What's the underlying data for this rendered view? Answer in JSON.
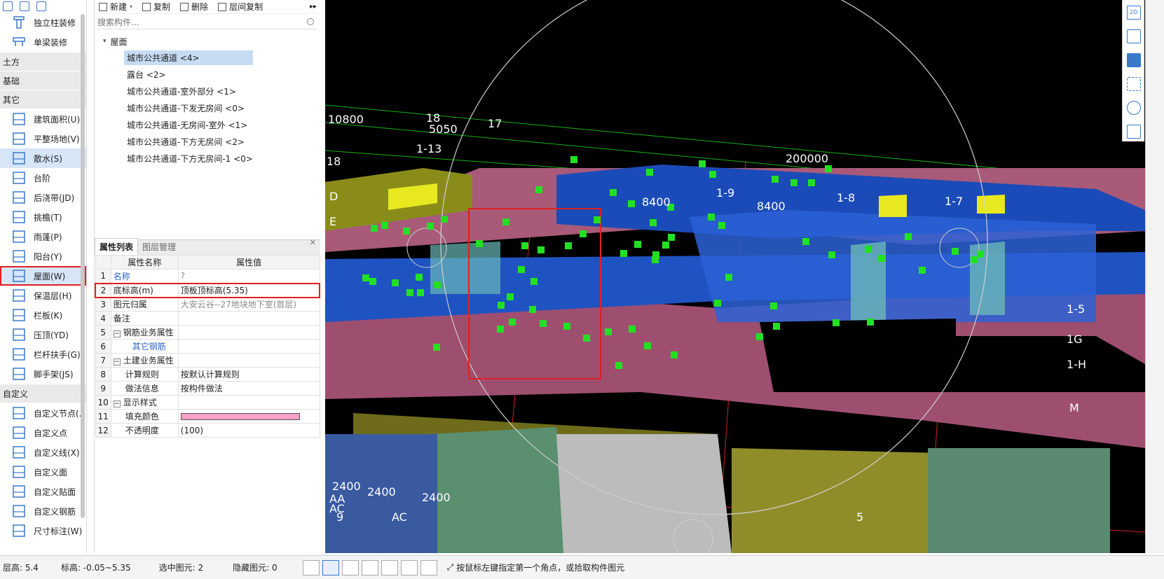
{
  "sidebar": {
    "top_items": [
      {
        "label": "独立柱装修",
        "icon": "column-finish-icon"
      },
      {
        "label": "单梁装修",
        "icon": "beam-finish-icon"
      }
    ],
    "categories": {
      "earthwork": "土方",
      "foundation": "基础",
      "other": "其它",
      "custom": "自定义"
    },
    "other_items": [
      {
        "label": "建筑面积(U)",
        "icon": "building-area-icon"
      },
      {
        "label": "平整场地(V)",
        "icon": "site-leveling-icon"
      },
      {
        "label": "散水(S)",
        "icon": "apron-icon"
      },
      {
        "label": "台阶",
        "icon": "steps-icon"
      },
      {
        "label": "后浇带(JD)",
        "icon": "post-pour-strip-icon"
      },
      {
        "label": "挑檐(T)",
        "icon": "eave-icon"
      },
      {
        "label": "雨蓬(P)",
        "icon": "canopy-icon"
      },
      {
        "label": "阳台(Y)",
        "icon": "balcony-icon"
      },
      {
        "label": "屋面(W)",
        "icon": "roof-icon"
      },
      {
        "label": "保温层(H)",
        "icon": "insulation-icon"
      },
      {
        "label": "栏板(K)",
        "icon": "parapet-icon"
      },
      {
        "label": "压顶(YD)",
        "icon": "coping-icon"
      },
      {
        "label": "栏杆扶手(G)",
        "icon": "railing-icon"
      },
      {
        "label": "脚手架(JS)",
        "icon": "scaffold-icon"
      }
    ],
    "custom_items": [
      {
        "label": "自定义节点(.",
        "icon": "custom-node-icon"
      },
      {
        "label": "自定义点",
        "icon": "custom-point-icon"
      },
      {
        "label": "自定义线(X)",
        "icon": "custom-line-icon"
      },
      {
        "label": "自定义面",
        "icon": "custom-face-icon"
      },
      {
        "label": "自定义贴面",
        "icon": "custom-veneer-icon"
      },
      {
        "label": "自定义钢筋",
        "icon": "custom-rebar-icon"
      },
      {
        "label": "尺寸标注(W)",
        "icon": "dimension-icon"
      }
    ]
  },
  "toolbar": {
    "new_label": "新建",
    "copy_label": "复制",
    "delete_label": "删除",
    "floor_copy_label": "层间复制"
  },
  "search": {
    "placeholder": "搜索构件..."
  },
  "tree": {
    "root": "屋面",
    "items": [
      "城市公共通道 <4>",
      "露台 <2>",
      "城市公共通道-室外部分 <1>",
      "城市公共通道-下发无房间 <0>",
      "城市公共通道-无房间-室外 <1>",
      "城市公共通道-下方无房间 <2>",
      "城市公共通道-下方无房间-1 <0>"
    ]
  },
  "property_tabs": {
    "active": "属性列表",
    "inactive": "图层管理"
  },
  "property_table": {
    "header_name": "属性名称",
    "header_value": "属性值",
    "rows": [
      {
        "n": "1",
        "name": "名称",
        "value": "?"
      },
      {
        "n": "2",
        "name": "底标高(m)",
        "value": "顶板顶标高(5.35)"
      },
      {
        "n": "3",
        "name": "图元归属",
        "value": "大安云谷--27地块地下室(首层)"
      },
      {
        "n": "4",
        "name": "备注",
        "value": ""
      },
      {
        "n": "5",
        "name": "钢筋业务属性",
        "value": ""
      },
      {
        "n": "6",
        "name": "其它钢筋",
        "value": ""
      },
      {
        "n": "7",
        "name": "土建业务属性",
        "value": ""
      },
      {
        "n": "8",
        "name": "计算规则",
        "value": "按默认计算规则"
      },
      {
        "n": "9",
        "name": "做法信息",
        "value": "按构件做法"
      },
      {
        "n": "10",
        "name": "显示样式",
        "value": ""
      },
      {
        "n": "11",
        "name": "填充颜色",
        "value": ""
      },
      {
        "n": "12",
        "name": "不透明度",
        "value": "(100)"
      }
    ],
    "fill_color": "#f7a0c8"
  },
  "viewport": {
    "labels": [
      "10800",
      "18",
      "5050",
      "17",
      "1-13",
      "18",
      "200000",
      "8400",
      "1-9",
      "8400",
      "1-8",
      "1-7",
      "2400",
      "2400",
      "AC",
      "9",
      "5",
      "1-5",
      "1G",
      "1-H",
      "M",
      "D",
      "E",
      "2400",
      "AA",
      "AC"
    ],
    "right_toolbar": [
      "2D",
      "cube-view",
      "cube-view-2",
      "fullscreen",
      "view-options",
      "layer-list"
    ]
  },
  "status": {
    "floor_height": "层高:  5.4",
    "elevation": "标高:  -0.05~5.35",
    "selected": "选中图元:  2",
    "hidden": "隐藏图元:  0",
    "hint": "按鼠标左键指定第一个角点，或拾取构件图元"
  }
}
